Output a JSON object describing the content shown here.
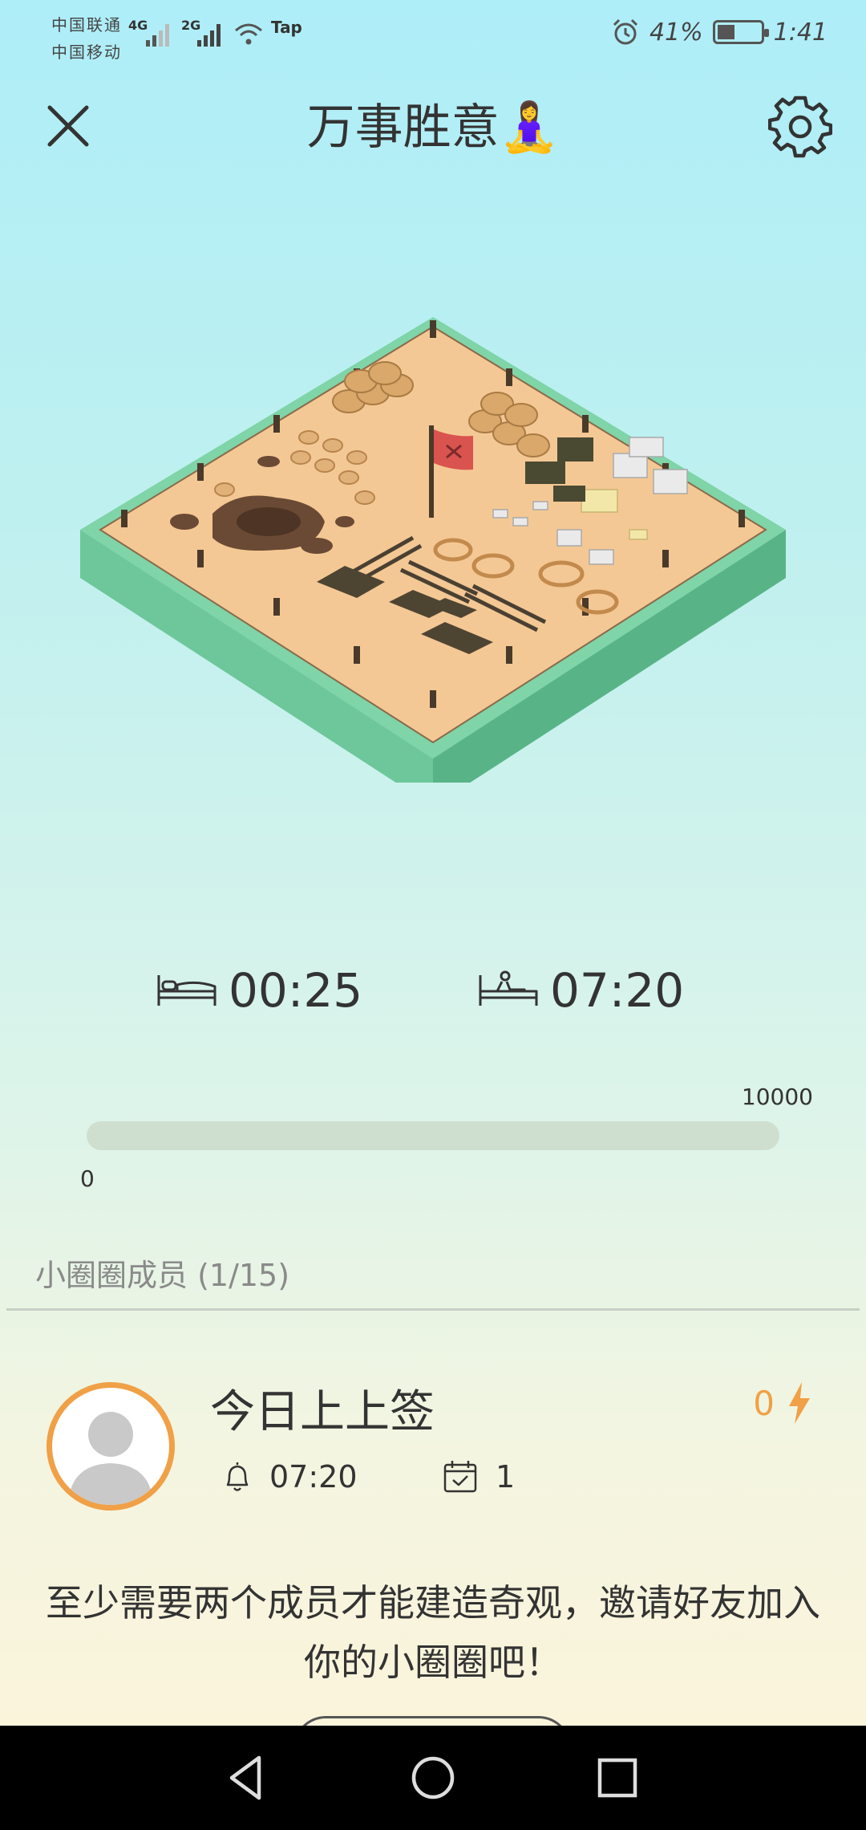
{
  "status_bar": {
    "carrier1": "中国联通",
    "carrier2": "中国移动",
    "net1": "4G",
    "net2": "2G",
    "tap_label": "Tap",
    "battery": "41%",
    "time": "1:41",
    "battery_level": 0.41
  },
  "header": {
    "title": "万事胜意🧘‍♀️"
  },
  "sleep": {
    "bed_time": "00:25",
    "wake_time": "07:20"
  },
  "progress": {
    "max_label": "10000",
    "min_label": "0",
    "value": 0
  },
  "members": {
    "label": "小圈圈成员 (1/15)",
    "items": [
      {
        "name": "今日上上签",
        "energy": "0",
        "alarm_time": "07:20",
        "checkin_count": "1"
      }
    ]
  },
  "invite_text": "至少需要两个成员才能建造奇观，邀请好友加入你的小圈圈吧！",
  "colors": {
    "accent_orange": "#f0a046",
    "grass": "#6fcaa0",
    "sand": "#f3c793",
    "progress_track": "#cfdfcf"
  },
  "icons": [
    "close-icon",
    "gear-icon",
    "bed-icon",
    "wake-icon",
    "bell-icon",
    "calendar-check-icon",
    "lightning-icon",
    "back-icon",
    "home-icon",
    "recent-icon"
  ]
}
